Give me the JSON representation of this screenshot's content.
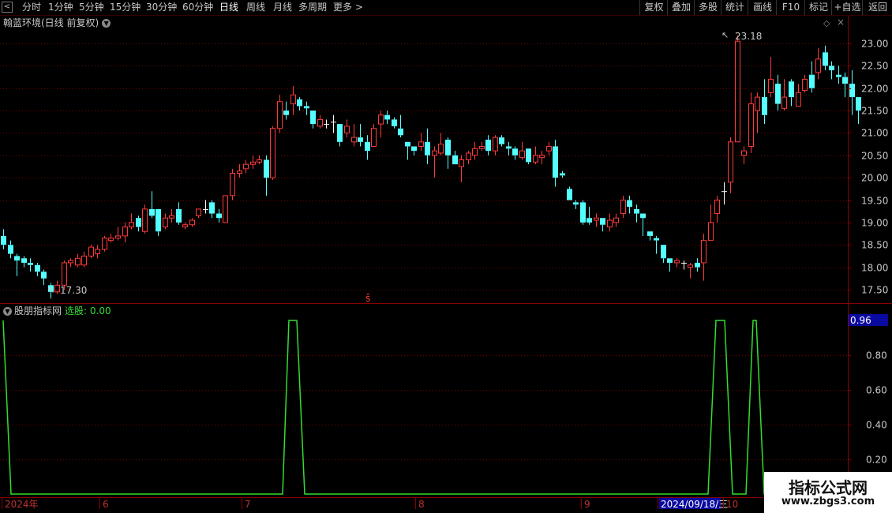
{
  "toolbar": {
    "back_glyph": "<",
    "periods": [
      "分时",
      "1分钟",
      "5分钟",
      "15分钟",
      "30分钟",
      "60分钟",
      "日线",
      "周线",
      "月线",
      "多周期",
      "更多 >"
    ],
    "active_period": "日线",
    "right_buttons": [
      "复权",
      "叠加",
      "多股",
      "统计",
      "画线",
      "F10",
      "标记",
      "+自选",
      "返回"
    ]
  },
  "main_chart": {
    "title": "翰蓝环境(日线 前复权)",
    "high_label": "23.18",
    "low_label": "17.30",
    "signal_glyph": "ŝ",
    "y_ticks": [
      "23.00",
      "22.50",
      "22.00",
      "21.50",
      "21.00",
      "20.50",
      "20.00",
      "19.50",
      "19.00",
      "18.50",
      "18.00",
      "17.50"
    ],
    "colors": {
      "up": "#ff3a3a",
      "down": "#54ffff",
      "grid": "#7a0000",
      "axis": "#8a0000",
      "flat": "#ffffff"
    }
  },
  "indicator": {
    "name": "股朋指标网",
    "select_label": "选股: 0.00",
    "current_value": "0.96",
    "y_ticks": [
      "0.80",
      "0.60",
      "0.40",
      "0.20"
    ],
    "line_color": "#33dd33",
    "values": [
      1,
      0,
      0,
      0,
      0,
      0,
      0,
      0,
      0,
      0,
      0,
      0,
      0,
      0,
      0,
      0,
      0,
      0,
      0,
      0,
      0,
      0,
      0,
      0,
      0,
      0,
      0,
      0,
      0,
      0,
      0,
      0,
      0,
      0,
      0,
      0,
      0,
      0,
      0,
      0,
      0,
      0,
      0,
      0,
      0,
      0,
      0,
      0,
      0,
      0,
      0,
      0,
      0,
      0,
      0,
      0,
      0,
      0,
      0,
      0,
      0,
      0,
      0,
      0,
      0,
      0,
      0,
      0,
      0,
      0,
      0,
      0,
      0,
      0,
      0,
      0,
      0,
      0,
      0,
      0,
      0,
      0,
      0,
      0,
      0,
      0,
      0,
      0,
      0,
      0,
      0,
      0,
      0,
      0,
      0,
      0,
      0,
      0,
      0,
      0,
      0,
      0,
      0,
      0,
      0,
      0,
      0,
      0,
      0,
      0,
      0,
      0,
      0,
      0,
      0,
      0,
      0,
      0,
      0,
      0,
      0,
      0,
      0,
      0,
      0,
      0,
      0,
      0,
      0,
      0,
      0,
      0,
      0,
      0,
      0,
      0,
      0,
      0,
      0,
      0,
      0,
      0,
      0,
      0,
      0,
      0,
      0,
      0,
      0,
      0,
      0,
      0,
      0,
      0,
      0,
      0,
      0,
      0,
      0,
      0,
      0,
      0,
      0,
      0,
      0,
      0,
      0,
      0,
      0,
      0,
      0,
      0,
      0,
      0,
      0,
      0,
      0,
      0,
      0,
      0,
      0,
      0,
      0,
      0,
      0,
      0,
      0,
      0,
      0,
      0,
      0,
      0,
      0,
      0,
      0,
      0,
      0,
      0,
      0,
      0,
      0,
      0,
      0,
      0,
      0,
      0,
      0,
      0,
      0,
      0,
      0,
      0,
      0,
      0,
      0,
      0,
      0,
      0,
      0,
      0,
      0,
      0,
      0,
      0,
      0,
      0,
      0,
      0,
      0,
      0,
      0,
      0,
      0,
      0,
      0,
      0,
      0,
      0,
      0,
      0,
      0,
      0,
      0,
      0,
      0,
      0,
      0,
      0,
      0,
      0,
      0,
      0,
      0
    ]
  },
  "date_axis": {
    "labels": [
      "2024年",
      "6",
      "7",
      "8",
      "9",
      "2024/09/18/三",
      "10"
    ]
  },
  "watermark": {
    "line1": "指标公式网",
    "line2": "www.zbgs3.com"
  },
  "chart_data": {
    "type": "candlestick",
    "x_unit": "trading day",
    "ylim": [
      17.2,
      23.3
    ],
    "candles": [
      [
        18.7,
        18.5,
        18.85,
        18.4
      ],
      [
        18.5,
        18.3,
        18.6,
        18.2
      ],
      [
        18.25,
        18.15,
        18.3,
        17.8
      ],
      [
        18.2,
        18.1,
        18.25,
        18.0
      ],
      [
        18.1,
        18.05,
        18.2,
        17.9
      ],
      [
        18.05,
        17.9,
        18.1,
        17.8
      ],
      [
        17.9,
        17.75,
        17.95,
        17.6
      ],
      [
        17.6,
        17.45,
        17.65,
        17.3
      ],
      [
        17.45,
        17.6,
        17.7,
        17.4
      ],
      [
        17.6,
        18.1,
        18.15,
        17.5
      ],
      [
        18.1,
        18.15,
        18.2,
        18.0
      ],
      [
        18.05,
        18.2,
        18.3,
        18.0
      ],
      [
        18.05,
        18.25,
        18.35,
        18.0
      ],
      [
        18.25,
        18.45,
        18.5,
        18.2
      ],
      [
        18.3,
        18.4,
        18.5,
        18.2
      ],
      [
        18.4,
        18.65,
        18.7,
        18.35
      ],
      [
        18.6,
        18.65,
        18.75,
        18.55
      ],
      [
        18.65,
        18.7,
        18.9,
        18.6
      ],
      [
        18.7,
        18.9,
        19.0,
        18.55
      ],
      [
        18.9,
        19.0,
        19.2,
        18.85
      ],
      [
        19.1,
        18.9,
        19.15,
        18.8
      ],
      [
        18.8,
        19.3,
        19.4,
        18.75
      ],
      [
        19.3,
        19.15,
        19.7,
        19.1
      ],
      [
        19.3,
        18.8,
        19.3,
        18.7
      ],
      [
        18.9,
        19.1,
        19.2,
        18.85
      ],
      [
        19.1,
        19.15,
        19.3,
        19.0
      ],
      [
        19.3,
        19.0,
        19.45,
        18.95
      ],
      [
        18.9,
        18.95,
        19.0,
        18.85
      ],
      [
        18.95,
        19.05,
        19.1,
        18.9
      ],
      [
        19.15,
        19.3,
        19.3,
        19.1
      ],
      [
        19.3,
        19.3,
        19.5,
        19.2
      ],
      [
        19.45,
        19.2,
        19.5,
        19.1
      ],
      [
        19.2,
        19.1,
        19.3,
        19.0
      ],
      [
        19.0,
        19.6,
        19.6,
        19.0
      ],
      [
        19.6,
        20.1,
        20.2,
        19.5
      ],
      [
        20.1,
        20.15,
        20.3,
        20.0
      ],
      [
        20.2,
        20.3,
        20.4,
        20.1
      ],
      [
        20.3,
        20.35,
        20.5,
        20.2
      ],
      [
        20.35,
        20.4,
        20.5,
        20.3
      ],
      [
        20.4,
        20.0,
        20.5,
        19.6
      ],
      [
        20.0,
        21.1,
        21.15,
        19.95
      ],
      [
        21.1,
        21.7,
        21.85,
        21.0
      ],
      [
        21.5,
        21.4,
        21.7,
        21.3
      ],
      [
        21.65,
        21.85,
        22.05,
        21.4
      ],
      [
        21.75,
        21.6,
        21.8,
        21.5
      ],
      [
        21.6,
        21.55,
        21.7,
        21.4
      ],
      [
        21.5,
        21.2,
        21.5,
        21.1
      ],
      [
        21.15,
        21.3,
        21.4,
        21.1
      ],
      [
        21.2,
        21.2,
        21.3,
        21.1
      ],
      [
        21.25,
        21.25,
        21.4,
        21.0
      ],
      [
        21.2,
        20.8,
        21.2,
        20.7
      ],
      [
        21.0,
        21.15,
        21.3,
        20.9
      ],
      [
        20.8,
        20.9,
        21.2,
        20.7
      ],
      [
        20.9,
        20.8,
        21.2,
        20.7
      ],
      [
        20.8,
        20.6,
        20.95,
        20.4
      ],
      [
        20.7,
        21.1,
        21.2,
        20.7
      ],
      [
        21.2,
        21.4,
        21.5,
        20.9
      ],
      [
        21.4,
        21.3,
        21.5,
        21.2
      ],
      [
        21.3,
        21.15,
        21.35,
        21.1
      ],
      [
        21.1,
        20.95,
        21.4,
        20.9
      ],
      [
        20.8,
        20.7,
        20.8,
        20.4
      ],
      [
        20.7,
        20.6,
        20.7,
        20.5
      ],
      [
        20.7,
        20.8,
        21.0,
        20.6
      ],
      [
        20.8,
        20.5,
        21.1,
        20.3
      ],
      [
        20.5,
        20.6,
        20.7,
        20.0
      ],
      [
        20.55,
        20.75,
        21.0,
        20.5
      ],
      [
        20.85,
        20.5,
        20.9,
        20.2
      ],
      [
        20.5,
        20.3,
        20.6,
        20.3
      ],
      [
        20.25,
        20.4,
        20.5,
        19.9
      ],
      [
        20.4,
        20.55,
        20.6,
        20.3
      ],
      [
        20.5,
        20.65,
        20.8,
        20.4
      ],
      [
        20.65,
        20.7,
        20.8,
        20.6
      ],
      [
        20.85,
        20.6,
        20.95,
        20.5
      ],
      [
        20.6,
        20.9,
        20.95,
        20.5
      ],
      [
        20.9,
        20.75,
        20.95,
        20.7
      ],
      [
        20.7,
        20.65,
        20.8,
        20.5
      ],
      [
        20.65,
        20.5,
        20.7,
        20.4
      ],
      [
        20.45,
        20.6,
        20.8,
        20.4
      ],
      [
        20.65,
        20.35,
        20.65,
        20.3
      ],
      [
        20.35,
        20.5,
        20.7,
        20.3
      ],
      [
        20.45,
        20.5,
        20.6,
        20.3
      ],
      [
        20.6,
        20.7,
        20.8,
        20.5
      ],
      [
        20.7,
        20.0,
        20.85,
        19.8
      ],
      [
        20.1,
        20.05,
        20.15,
        20.0
      ],
      [
        19.75,
        19.5,
        19.8,
        19.5
      ],
      [
        19.45,
        19.4,
        19.5,
        19.3
      ],
      [
        19.45,
        19.0,
        19.5,
        18.95
      ],
      [
        19.1,
        19.0,
        19.35,
        18.95
      ],
      [
        19.05,
        19.1,
        19.2,
        18.9
      ],
      [
        19.1,
        18.95,
        19.1,
        18.8
      ],
      [
        18.9,
        19.05,
        19.2,
        18.8
      ],
      [
        19.0,
        19.1,
        19.2,
        18.9
      ],
      [
        19.2,
        19.5,
        19.6,
        19.1
      ],
      [
        19.5,
        19.35,
        19.6,
        19.2
      ],
      [
        19.3,
        19.2,
        19.4,
        19.0
      ],
      [
        19.2,
        19.1,
        19.2,
        18.7
      ],
      [
        18.8,
        18.7,
        18.8,
        18.6
      ],
      [
        18.65,
        18.6,
        18.7,
        18.3
      ],
      [
        18.5,
        18.2,
        18.5,
        18.1
      ],
      [
        18.2,
        18.1,
        18.2,
        17.9
      ],
      [
        18.1,
        18.15,
        18.2,
        18.0
      ],
      [
        18.1,
        18.1,
        18.15,
        17.95
      ],
      [
        18.0,
        18.05,
        18.1,
        17.75
      ],
      [
        18.1,
        18.0,
        18.2,
        17.9
      ],
      [
        18.1,
        18.6,
        18.75,
        17.7
      ],
      [
        18.6,
        19.0,
        19.4,
        18.6
      ],
      [
        19.2,
        19.5,
        19.6,
        19.0
      ],
      [
        19.7,
        19.7,
        19.9,
        19.4
      ],
      [
        19.9,
        20.8,
        20.9,
        19.65
      ],
      [
        20.8,
        23.05,
        23.18,
        20.8
      ],
      [
        20.5,
        20.6,
        20.7,
        20.3
      ],
      [
        20.7,
        21.65,
        21.9,
        20.55
      ],
      [
        21.5,
        21.8,
        21.9,
        21.0
      ],
      [
        21.8,
        21.4,
        22.2,
        21.2
      ],
      [
        21.9,
        22.2,
        22.7,
        21.8
      ],
      [
        22.1,
        21.65,
        22.3,
        21.5
      ],
      [
        21.55,
        21.8,
        22.2,
        21.5
      ],
      [
        22.15,
        21.8,
        22.2,
        21.6
      ],
      [
        21.6,
        21.9,
        22.1,
        21.6
      ],
      [
        21.95,
        22.2,
        22.3,
        21.9
      ],
      [
        22.3,
        22.0,
        22.6,
        21.9
      ],
      [
        22.35,
        22.65,
        22.9,
        22.2
      ],
      [
        22.8,
        22.5,
        22.95,
        22.4
      ],
      [
        22.5,
        22.4,
        22.6,
        22.2
      ],
      [
        22.3,
        22.25,
        22.5,
        22.1
      ],
      [
        22.25,
        22.1,
        22.35,
        21.8
      ],
      [
        22.1,
        21.8,
        22.4,
        21.4
      ],
      [
        21.8,
        21.5,
        21.8,
        21.2
      ]
    ]
  }
}
